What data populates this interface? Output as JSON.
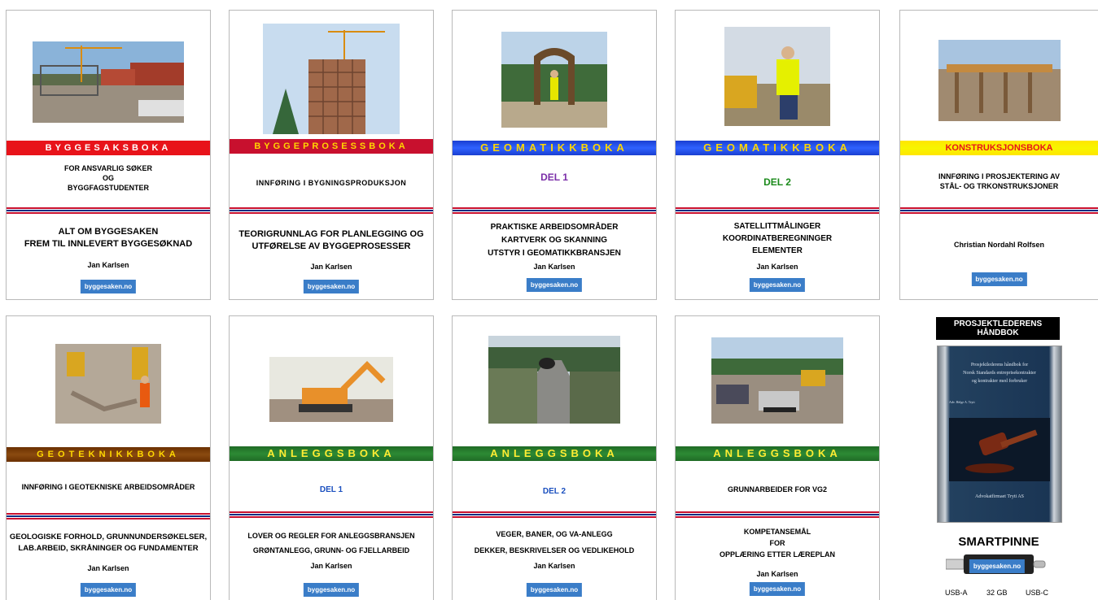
{
  "cards": [
    {
      "band": "BYGGESAKSBOKA",
      "sub": [
        "FOR ANSVARLIG SØKER",
        "OG",
        "BYGGFAGSTUDENTER"
      ],
      "main": [
        "ALT OM BYGGESAKEN",
        "FREM TIL INNLEVERT BYGGESØKNAD"
      ],
      "author": "Jan Karlsen",
      "badge": "byggesaken.no"
    },
    {
      "band": "BYGGEPROSESSBOKA",
      "sub": [
        "INNFØRING I BYGNINGSPRODUKSJON"
      ],
      "main": [
        "TEORIGRUNNLAG FOR PLANLEGGING OG",
        "UTFØRELSE AV BYGGEPROSESSER"
      ],
      "author": "Jan Karlsen",
      "badge": "byggesaken.no"
    },
    {
      "band": "GEOMATIKKBOKA",
      "del": "DEL 1",
      "main": [
        "PRAKTISKE ARBEIDSOMRÅDER",
        "KARTVERK OG SKANNING",
        "UTSTYR I GEOMATIKKBRANSJEN"
      ],
      "author": "Jan Karlsen",
      "badge": "byggesaken.no"
    },
    {
      "band": "GEOMATIKKBOKA",
      "del": "DEL 2",
      "main": [
        "SATELLITTMÅLINGER",
        "KOORDINATBEREGNINGER",
        "ELEMENTER"
      ],
      "author": "Jan Karlsen",
      "badge": "byggesaken.no"
    },
    {
      "band": "KONSTRUKSJONSBOKA",
      "sub": [
        "INNFØRING I PROSJEKTERING AV",
        "STÅL- OG TRKONSTRUKSJONER"
      ],
      "author": "Christian Nordahl Rolfsen",
      "badge": "byggesaken.no"
    },
    {
      "band": "GEOTEKNIKKBOKA",
      "sub": [
        "INNFØRING I GEOTEKNISKE ARBEIDSOMRÅDER"
      ],
      "main": [
        "GEOLOGISKE FORHOLD, GRUNNUNDERSØKELSER,",
        "LAB.ARBEID, SKRÅNINGER OG FUNDAMENTER"
      ],
      "author": "Jan Karlsen",
      "badge": "byggesaken.no"
    },
    {
      "band": "ANLEGGSBOKA",
      "del": "DEL 1",
      "main": [
        "LOVER OG REGLER FOR ANLEGGSBRANSJEN",
        "GRØNTANLEGG, GRUNN- OG FJELLARBEID"
      ],
      "author": "Jan Karlsen",
      "badge": "byggesaken.no"
    },
    {
      "band": "ANLEGGSBOKA",
      "del": "DEL 2",
      "main": [
        "VEGER, BANER, OG VA-ANLEGG",
        "DEKKER, BESKRIVELSER OG VEDLIKEHOLD"
      ],
      "author": "Jan Karlsen",
      "badge": "byggesaken.no"
    },
    {
      "band": "ANLEGGSBOKA",
      "sub": [
        "GRUNNARBEIDER FOR VG2"
      ],
      "main": [
        "KOMPETANSEMÅL",
        "FOR",
        "OPPLÆRING ETTER LÆREPLAN"
      ],
      "author": "Jan Karlsen",
      "badge": "byggesaken.no"
    }
  ],
  "projektleder": {
    "title": "PROSJEKTLEDERENS HÅNDBOK",
    "book_lines": [
      "Prosjektlederens håndbok for",
      "Norsk Standards entreprisekontrakter",
      "og kontrakter med forbruker"
    ],
    "book_author": "Adv. Helge A. Tryti",
    "book_publisher": "Advokatfirmaet Tryti AS",
    "smartpinne": "SMARTPINNE",
    "usb_badge": "byggesaken.no",
    "usb_labels": [
      "USB-A",
      "32 GB",
      "USB-C"
    ]
  },
  "colors": {
    "accent_blue": "#3a7dc8",
    "norway_red": "#c8102e",
    "norway_blue": "#0c2d83"
  }
}
